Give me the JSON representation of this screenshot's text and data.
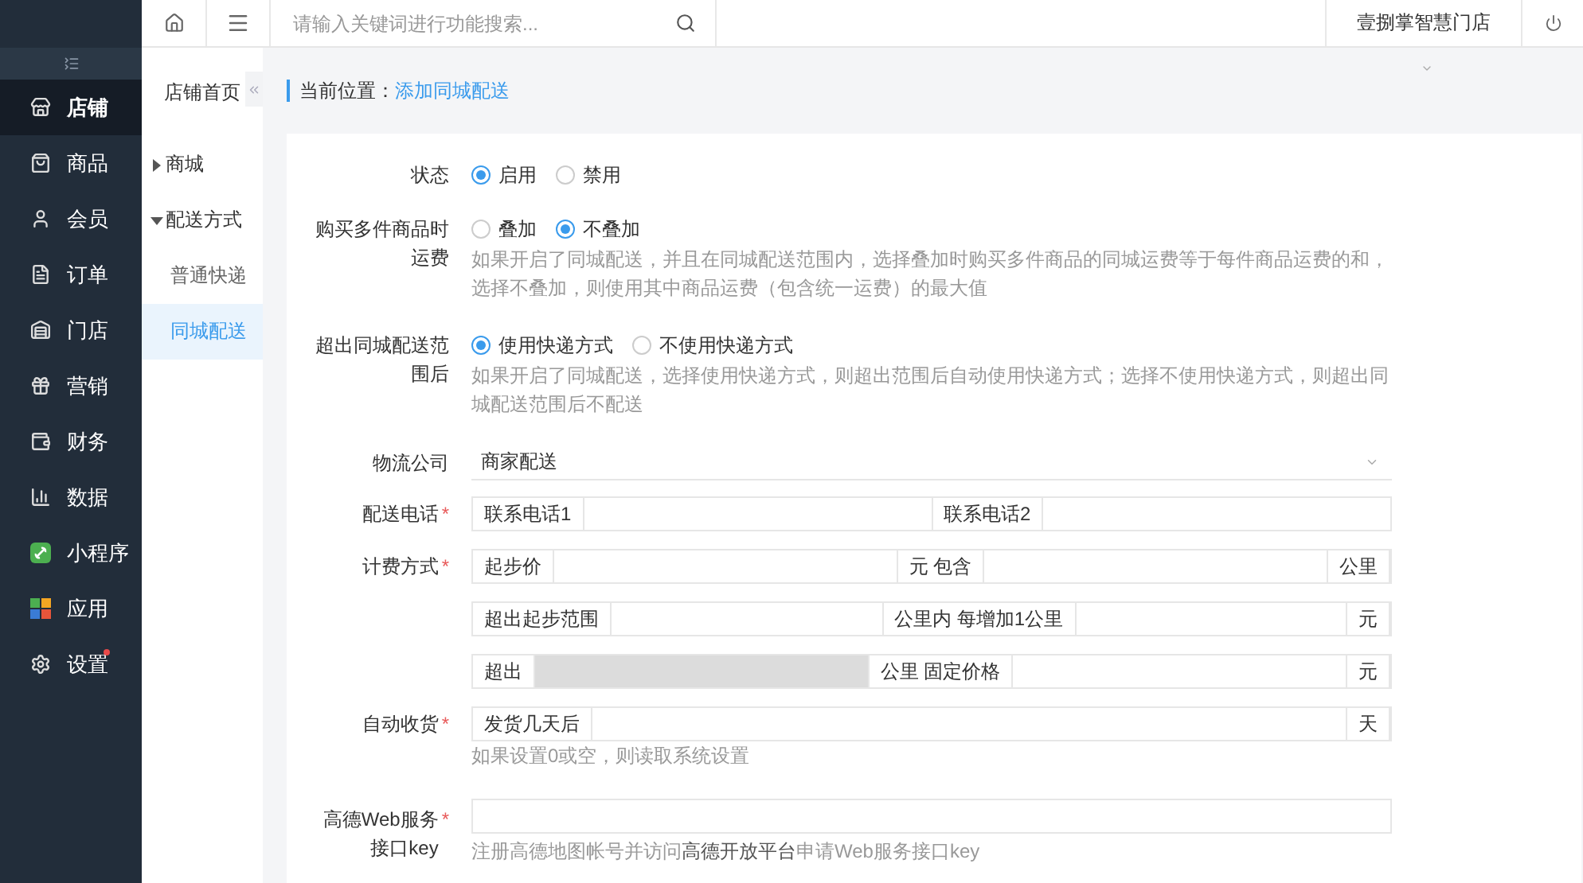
{
  "topbar": {
    "search_placeholder": "请输入关键词进行功能搜索...",
    "store_name": "壹捌掌智慧门店"
  },
  "sidebar": {
    "items": [
      {
        "label": "店铺",
        "selected": true,
        "badge": false
      },
      {
        "label": "商品",
        "selected": false,
        "badge": false
      },
      {
        "label": "会员",
        "selected": false,
        "badge": false
      },
      {
        "label": "订单",
        "selected": false,
        "badge": false
      },
      {
        "label": "门店",
        "selected": false,
        "badge": false
      },
      {
        "label": "营销",
        "selected": false,
        "badge": false
      },
      {
        "label": "财务",
        "selected": false,
        "badge": false
      },
      {
        "label": "数据",
        "selected": false,
        "badge": false
      },
      {
        "label": "小程序",
        "selected": false,
        "badge": false
      },
      {
        "label": "应用",
        "selected": false,
        "badge": false
      },
      {
        "label": "设置",
        "selected": false,
        "badge": true
      }
    ]
  },
  "subnav": {
    "title": "店铺首页",
    "items": [
      {
        "label": "商城",
        "expanded": false
      },
      {
        "label": "配送方式",
        "expanded": true,
        "children": [
          {
            "label": "普通快递",
            "selected": false
          },
          {
            "label": "同城配送",
            "selected": true
          }
        ]
      }
    ]
  },
  "breadcrumb": {
    "label": "当前位置：",
    "current": "添加同城配送"
  },
  "form": {
    "rows": [
      {
        "kind": "radio",
        "label": "状态",
        "options": [
          {
            "label": "启用",
            "selected": true
          },
          {
            "label": "禁用",
            "selected": false
          }
        ]
      },
      {
        "kind": "radio",
        "label": "购买多件商品时运费",
        "options": [
          {
            "label": "叠加",
            "selected": false
          },
          {
            "label": "不叠加",
            "selected": true
          }
        ],
        "hint": [
          "如果开启了同城配送，并且在同城配送范围内，选择叠加时购买多件商品的同城运费等于每件商品运费的和，选择不叠加，则使用其中商品运费（包含统一运费）的最大值"
        ]
      },
      {
        "kind": "radio",
        "label": "超出同城配送范围后",
        "options": [
          {
            "label": "使用快递方式",
            "selected": true
          },
          {
            "label": "不使用快递方式",
            "selected": false
          }
        ],
        "hint": [
          "如果开启了同城配送，选择使用快递方式，则超出范围后自动使用快递方式；选择不使用快递方式，则超出同城配送范围后不配送"
        ]
      },
      {
        "kind": "select",
        "label": "物流公司",
        "value": "商家配送"
      },
      {
        "kind": "group",
        "label": "配送电话",
        "required_mark": "*",
        "lines": [
          [
            {
              "kind": "addon",
              "text": "联系电话1"
            },
            {
              "kind": "input"
            },
            {
              "kind": "addon",
              "text": "联系电话2"
            },
            {
              "kind": "input"
            }
          ]
        ]
      },
      {
        "kind": "group",
        "label": "计费方式",
        "required_mark": "*",
        "lines": [
          [
            {
              "kind": "addon",
              "text": "起步价"
            },
            {
              "kind": "input"
            },
            {
              "kind": "addon",
              "text": "元 包含"
            },
            {
              "kind": "input"
            },
            {
              "kind": "addon",
              "text": "公里"
            }
          ],
          [
            {
              "kind": "addon",
              "text": "超出起步范围"
            },
            {
              "kind": "input"
            },
            {
              "kind": "addon",
              "text": "公里内 每增加1公里"
            },
            {
              "kind": "input"
            },
            {
              "kind": "addon",
              "text": "元"
            }
          ],
          [
            {
              "kind": "addon",
              "text": "超出"
            },
            {
              "kind": "disabled"
            },
            {
              "kind": "addon",
              "text": "公里 固定价格"
            },
            {
              "kind": "input"
            },
            {
              "kind": "addon",
              "text": "元"
            }
          ]
        ]
      },
      {
        "kind": "group",
        "label": "自动收货",
        "required_mark": "*",
        "lines": [
          [
            {
              "kind": "addon",
              "text": "发货几天后"
            },
            {
              "kind": "input"
            },
            {
              "kind": "addon",
              "text": "天"
            }
          ]
        ],
        "hint": [
          "如果设置0或空，则读取系统设置"
        ]
      },
      {
        "kind": "text",
        "label": "高德Web服务接口key",
        "required_mark": "*",
        "hint": [
          "注册高德地图帐号并访问",
          "高德开放平台",
          "申请Web服务接口key"
        ]
      }
    ]
  }
}
